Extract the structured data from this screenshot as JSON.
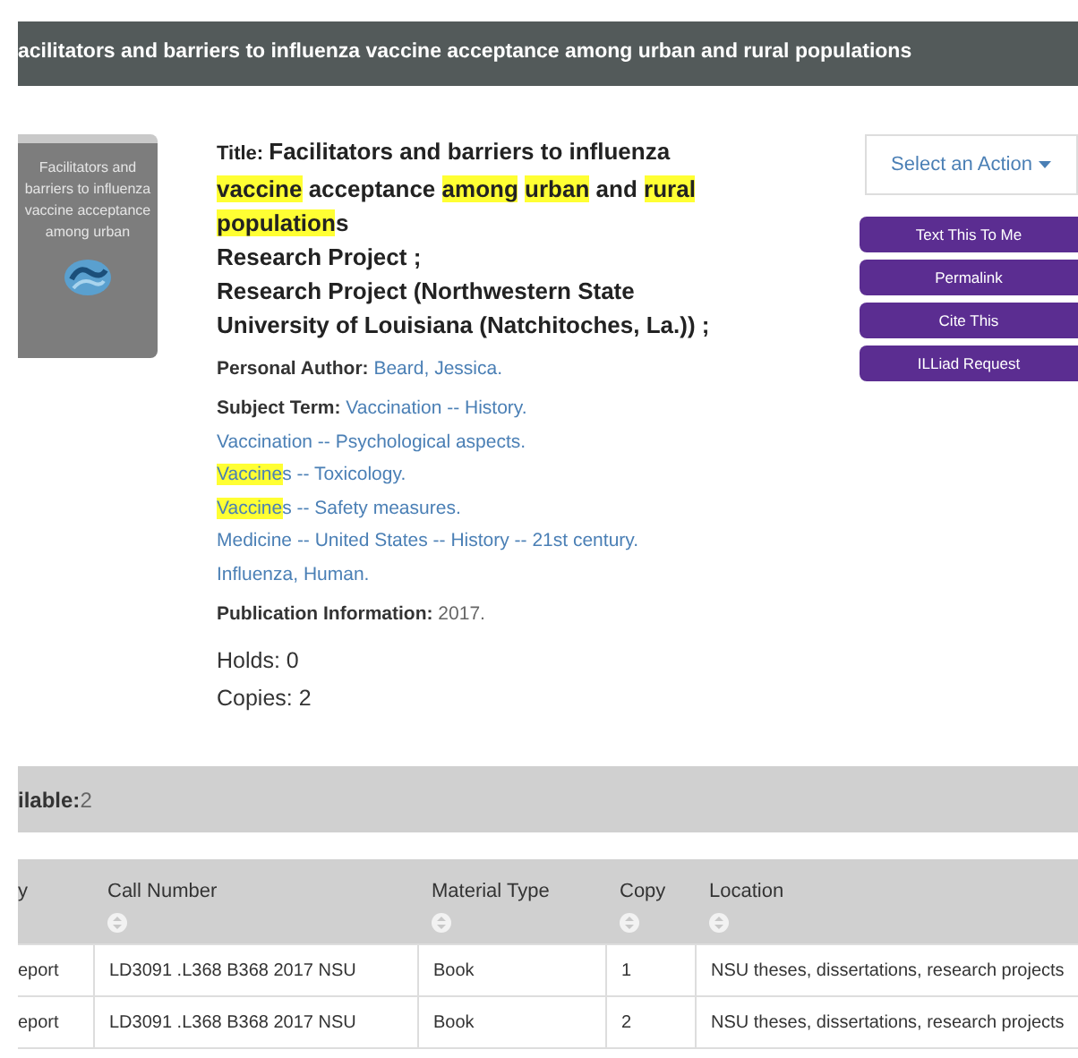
{
  "header": {
    "title": "acilitators and barriers to influenza vaccine acceptance among urban and rural populations"
  },
  "cover": {
    "text": "Facilitators and barriers to influenza vaccine acceptance among urban"
  },
  "record": {
    "title_label": "Title:",
    "title_words": [
      {
        "plain": "Facilitators and barriers to influenza"
      },
      {
        "highlighted": "vaccine"
      },
      {
        "plain": "acceptance"
      },
      {
        "highlighted": "among"
      },
      {
        "highlighted": "urban"
      },
      {
        "plain": "and"
      },
      {
        "highlighted": "rural"
      },
      {
        "highlighted": "population",
        "plain": "s"
      }
    ],
    "series": [
      "Research Project ;",
      "Research Project (Northwestern State University of Louisiana (Natchitoches, La.)) ;"
    ],
    "author_label": "Personal Author:",
    "author": "Beard, Jessica.",
    "subject_label": "Subject Term:",
    "subjects": [
      [
        {
          "plain": "Vaccination -- History."
        }
      ],
      [
        {
          "plain": "Vaccination -- Psychological aspects."
        }
      ],
      [
        {
          "highlighted": "Vaccine",
          "plain": "s -- Toxicology."
        }
      ],
      [
        {
          "highlighted": "Vaccine",
          "plain": "s -- Safety measures."
        }
      ],
      [
        {
          "plain": "Medicine -- United States -- History -- 21st century."
        }
      ],
      [
        {
          "plain": "Influenza, Human."
        }
      ]
    ],
    "publication_label": "Publication Information:",
    "publication": "2017.",
    "holds": "Holds: 0",
    "copies": "Copies: 2"
  },
  "actions": {
    "select": "Select an Action",
    "buttons": [
      "Text This To Me",
      "Permalink",
      "Cite This",
      "ILLiad Request"
    ]
  },
  "availability": {
    "label": "ilable:",
    "count": "2"
  },
  "table": {
    "columns": [
      "y",
      "Call Number",
      "Material Type",
      "Copy",
      "Location"
    ],
    "rows": [
      [
        "eport",
        "LD3091 .L368 B368 2017 NSU",
        "Book",
        "1",
        "NSU theses, dissertations, research projects"
      ],
      [
        "eport",
        "LD3091 .L368 B368 2017 NSU",
        "Book",
        "2",
        "NSU theses, dissertations, research projects"
      ]
    ]
  }
}
